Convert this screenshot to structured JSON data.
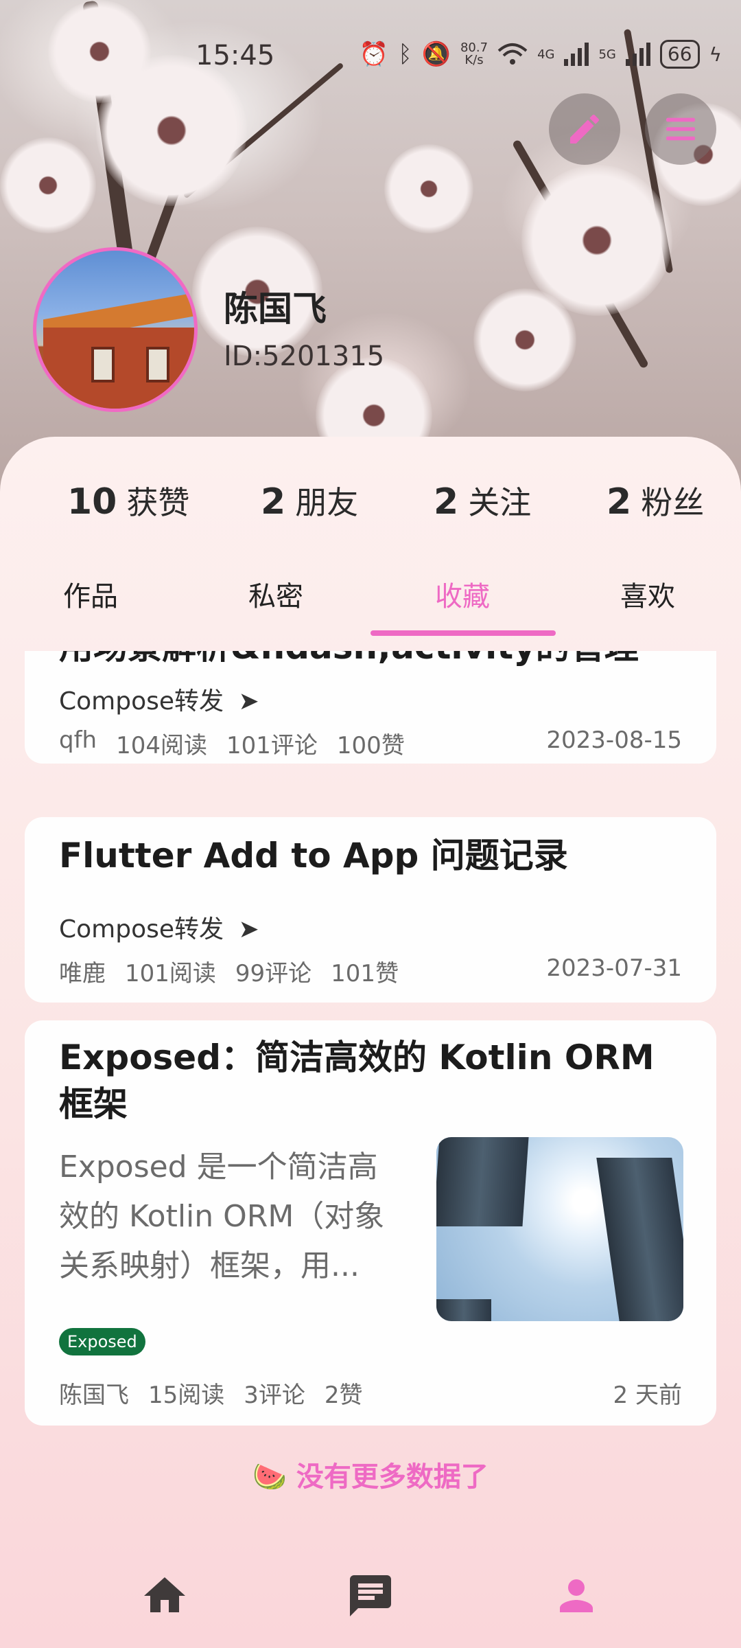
{
  "status_bar": {
    "time": "15:45",
    "speed_value": "80.7",
    "speed_unit": "K/s",
    "net1": "4G",
    "net2": "5G",
    "battery": "66"
  },
  "profile": {
    "name": "陈国飞",
    "id": "ID:5201315"
  },
  "stats": [
    {
      "value": "10",
      "label": "获赞"
    },
    {
      "value": "2",
      "label": "朋友"
    },
    {
      "value": "2",
      "label": "关注"
    },
    {
      "value": "2",
      "label": "粉丝"
    }
  ],
  "tabs": [
    {
      "label": "作品"
    },
    {
      "label": "私密"
    },
    {
      "label": "收藏",
      "active": true
    },
    {
      "label": "喜欢"
    }
  ],
  "articles": [
    {
      "title": "用场景解析&ndash;activity的管理",
      "category": "Compose转发",
      "author": "qfh",
      "reads": "104阅读",
      "comments": "101评论",
      "likes": "100赞",
      "date": "2023-08-15"
    },
    {
      "title": "Flutter Add to App 问题记录",
      "category": "Compose转发",
      "author": "唯鹿",
      "reads": "101阅读",
      "comments": "99评论",
      "likes": "101赞",
      "date": "2023-07-31"
    },
    {
      "title_line1": "Exposed：简洁高效的 Kotlin ORM",
      "title_line2": "框架",
      "summary_line1": "Exposed 是一个简洁高",
      "summary_line2": "效的 Kotlin ORM（对象",
      "summary_line3": "关系映射）框架，用...",
      "tag": "Exposed",
      "author": "陈国飞",
      "reads": "15阅读",
      "comments": "3评论",
      "likes": "2赞",
      "date": "2 天前"
    }
  ],
  "no_more": "🍉 没有更多数据了",
  "colors": {
    "accent": "#ee6ac4",
    "tag_bg": "#11733e"
  },
  "icons": [
    "edit-icon",
    "menu-icon",
    "home-icon",
    "message-icon",
    "person-icon"
  ]
}
